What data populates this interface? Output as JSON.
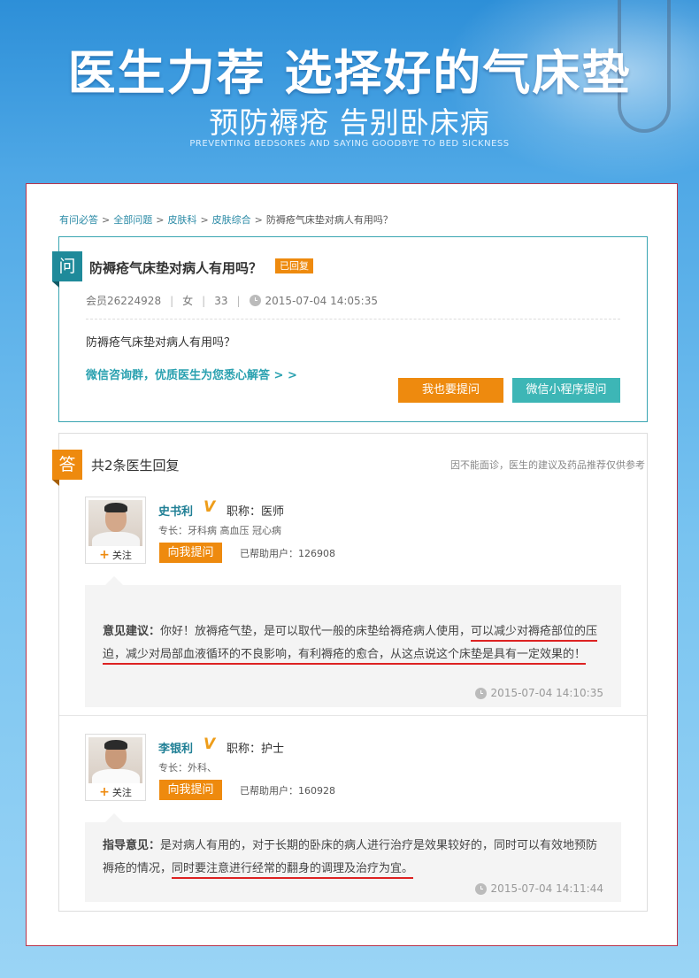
{
  "banner": {
    "title": "医生力荐 选择好的气床垫",
    "subtitle": "预防褥疮  告别卧床病",
    "english": "PREVENTING BEDSORES AND SAYING GOODBYE TO BED SICKNESS"
  },
  "breadcrumb": [
    "有问必答",
    "全部问题",
    "皮肤科",
    "皮肤综合",
    "防褥疮气床垫对病人有用吗？"
  ],
  "question": {
    "badge": "问",
    "title": "防褥疮气床垫对病人有用吗？",
    "status": "已回复",
    "member": "会员26224928",
    "gender": "女",
    "age": "33",
    "time": "2015-07-04 14:05:35",
    "body": "防褥疮气床垫对病人有用吗？",
    "wechat_group": "微信咨询群，优质医生为您悉心解答 > >",
    "ask_button": "我也要提问",
    "miniprogram_button": "微信小程序提问"
  },
  "answers": {
    "badge": "答",
    "title": "共2条医生回复",
    "note": "因不能面诊，医生的建议及药品推荐仅供参考",
    "follow": "关注",
    "ask_me": "向我提问",
    "items": [
      {
        "name": "史书利",
        "v": "V",
        "title": "职称：医师",
        "specialty": "专长：牙科病 高血压 冠心病",
        "helped": "已帮助用户：126908",
        "label": "意见建议：",
        "text1": "你好！放褥疮气垫，是可以取代一般的床垫给褥疮病人使用，",
        "text2": "可以减少对褥疮部位的压迫，减少对局部血液循环的不良影响，有利褥疮的愈合，从这点说这个床垫是具有一定效果的！",
        "time": "2015-07-04 14:10:35"
      },
      {
        "name": "李银利",
        "v": "V",
        "title": "职称：护士",
        "specialty": "专长：外科、",
        "helped": "已帮助用户：160928",
        "label": "指导意见：",
        "text1": "是对病人有用的，对于长期的卧床的病人进行治疗是效果较好的，同时可以有效地预防褥疮的情况，",
        "text2": "同时要注意进行经常的翻身的调理及治疗为宜。",
        "time": "2015-07-04 14:11:44"
      }
    ]
  }
}
